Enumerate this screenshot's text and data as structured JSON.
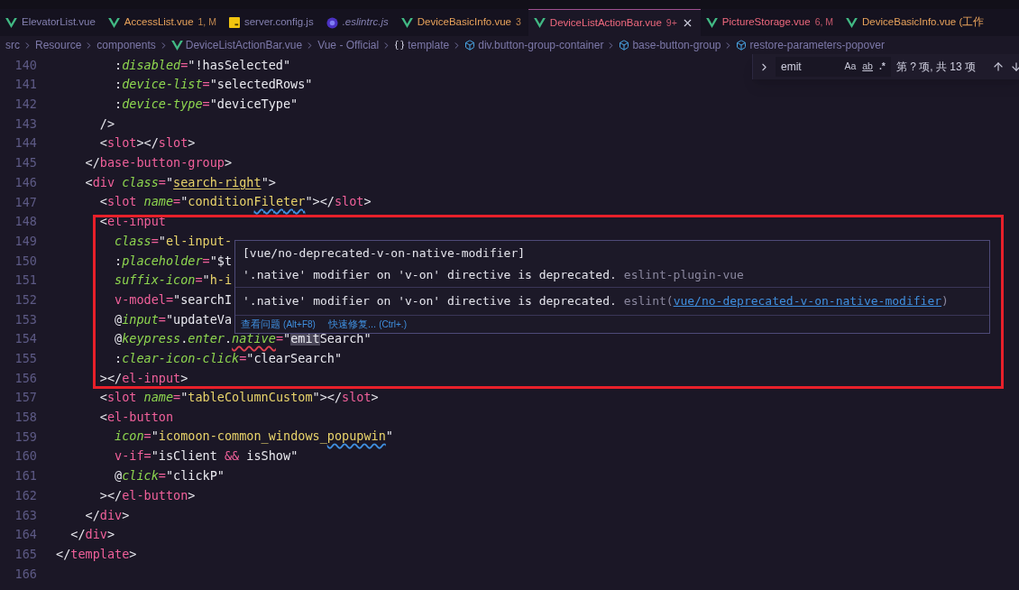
{
  "tabs": [
    {
      "label": "ElevatorList.vue",
      "kind": "vue",
      "color": "#8480b0",
      "selected": false
    },
    {
      "label": "AccessList.vue",
      "kind": "vue",
      "color": "#e9a35b",
      "badge": "1, M",
      "selected": false
    },
    {
      "label": "server.config.js",
      "kind": "js",
      "color": "#8480b0",
      "selected": false
    },
    {
      "label": ".eslintrc.js",
      "kind": "eslint",
      "color": "#8480b0",
      "italic": true,
      "selected": false
    },
    {
      "label": "DeviceBasicInfo.vue",
      "kind": "vue",
      "color": "#e9a35b",
      "badge": "3",
      "selected": false
    },
    {
      "label": "DeviceListActionBar.vue",
      "kind": "vue",
      "color": "#f0697e",
      "badge": "9+",
      "selected": true
    },
    {
      "label": "PictureStorage.vue",
      "kind": "vue",
      "color": "#f0697e",
      "badge": "6, M",
      "selected": false
    },
    {
      "label": "DeviceBasicInfo.vue (工作",
      "kind": "vue",
      "color": "#e9a35b",
      "selected": false
    }
  ],
  "breadcrumb": [
    {
      "label": "src"
    },
    {
      "label": "Resource"
    },
    {
      "label": "components"
    },
    {
      "label": "DeviceListActionBar.vue",
      "kind": "vue"
    },
    {
      "label": "Vue - Official"
    },
    {
      "label": "template",
      "kind": "braces"
    },
    {
      "label": "div.button-group-container",
      "kind": "cube"
    },
    {
      "label": "base-button-group",
      "kind": "cube"
    },
    {
      "label": "restore-parameters-popover",
      "kind": "cube"
    }
  ],
  "find": {
    "value": "emit",
    "options": [
      "Aa",
      "ab",
      ".*"
    ],
    "result": "第 ? 项, 共 13 项"
  },
  "lines": [
    {
      "number": "140",
      "tokens": [
        {
          "kind": "punct",
          "text": "        :"
        },
        {
          "kind": "attr",
          "text": "disabled"
        },
        {
          "kind": "op",
          "text": "="
        },
        {
          "kind": "expr",
          "text": "\"!hasSelected\""
        }
      ]
    },
    {
      "number": "141",
      "tokens": [
        {
          "kind": "punct",
          "text": "        :"
        },
        {
          "kind": "attr",
          "text": "device-list"
        },
        {
          "kind": "op",
          "text": "="
        },
        {
          "kind": "expr",
          "text": "\"selectedRows\""
        }
      ]
    },
    {
      "number": "142",
      "tokens": [
        {
          "kind": "punct",
          "text": "        :"
        },
        {
          "kind": "attr",
          "text": "device-type"
        },
        {
          "kind": "op",
          "text": "="
        },
        {
          "kind": "expr",
          "text": "\"deviceType\""
        }
      ]
    },
    {
      "number": "143",
      "tokens": [
        {
          "kind": "punct",
          "text": "      />"
        }
      ]
    },
    {
      "number": "144",
      "tokens": [
        {
          "kind": "punct",
          "text": "      <"
        },
        {
          "kind": "tag",
          "text": "slot"
        },
        {
          "kind": "punct",
          "text": "></"
        },
        {
          "kind": "tag",
          "text": "slot"
        },
        {
          "kind": "punct",
          "text": ">"
        }
      ]
    },
    {
      "number": "145",
      "tokens": [
        {
          "kind": "punct",
          "text": "    </"
        },
        {
          "kind": "tag",
          "text": "base-button-group"
        },
        {
          "kind": "punct",
          "text": ">"
        }
      ]
    },
    {
      "number": "146",
      "tokens": [
        {
          "kind": "punct",
          "text": "    <"
        },
        {
          "kind": "tag",
          "text": "div"
        },
        {
          "kind": "attr",
          "text": " class"
        },
        {
          "kind": "op",
          "text": "="
        },
        {
          "kind": "punct",
          "text": "\""
        },
        {
          "kind": "str",
          "text": "search-right",
          "underline": true
        },
        {
          "kind": "punct",
          "text": "\">"
        }
      ]
    },
    {
      "number": "147",
      "tokens": [
        {
          "kind": "punct",
          "text": "      <"
        },
        {
          "kind": "tag",
          "text": "slot"
        },
        {
          "kind": "attr",
          "text": " name"
        },
        {
          "kind": "op",
          "text": "="
        },
        {
          "kind": "punct",
          "text": "\""
        },
        {
          "kind": "str",
          "text": "condition"
        },
        {
          "kind": "str",
          "text": "Fileter",
          "misspelled": true
        },
        {
          "kind": "punct",
          "text": "\"></"
        },
        {
          "kind": "tag",
          "text": "slot"
        },
        {
          "kind": "punct",
          "text": ">"
        }
      ]
    },
    {
      "number": "148",
      "tokens": [
        {
          "kind": "punct",
          "text": "      <"
        },
        {
          "kind": "tag",
          "text": "el-input"
        }
      ]
    },
    {
      "number": "149",
      "tokens": [
        {
          "kind": "attr",
          "text": "        class"
        },
        {
          "kind": "op",
          "text": "="
        },
        {
          "kind": "punct",
          "text": "\""
        },
        {
          "kind": "str",
          "text": "el-input-"
        }
      ]
    },
    {
      "number": "150",
      "tokens": [
        {
          "kind": "punct",
          "text": "        :"
        },
        {
          "kind": "attr",
          "text": "placeholder"
        },
        {
          "kind": "op",
          "text": "="
        },
        {
          "kind": "expr",
          "text": "\"$t"
        }
      ]
    },
    {
      "number": "151",
      "tokens": [
        {
          "kind": "attr",
          "text": "        suffix-icon"
        },
        {
          "kind": "op",
          "text": "="
        },
        {
          "kind": "punct",
          "text": "\""
        },
        {
          "kind": "str",
          "text": "h-i"
        }
      ]
    },
    {
      "number": "152",
      "tokens": [
        {
          "kind": "op",
          "text": "        v-model"
        },
        {
          "kind": "op",
          "text": "="
        },
        {
          "kind": "expr",
          "text": "\"searchI"
        }
      ]
    },
    {
      "number": "153",
      "tokens": [
        {
          "kind": "punct",
          "text": "        @"
        },
        {
          "kind": "attr",
          "text": "input"
        },
        {
          "kind": "op",
          "text": "="
        },
        {
          "kind": "expr",
          "text": "\"updateVa"
        }
      ]
    },
    {
      "number": "154",
      "tokens": [
        {
          "kind": "punct",
          "text": "        @"
        },
        {
          "kind": "attr",
          "text": "keypress"
        },
        {
          "kind": "punct",
          "text": "."
        },
        {
          "kind": "attr",
          "text": "enter"
        },
        {
          "kind": "punct",
          "text": "."
        },
        {
          "kind": "attr",
          "text": "native",
          "error": true
        },
        {
          "kind": "op",
          "text": "="
        },
        {
          "kind": "expr",
          "text": "\""
        },
        {
          "kind": "expr",
          "text": "emit",
          "highlight": true
        },
        {
          "kind": "expr",
          "text": "Search\""
        }
      ]
    },
    {
      "number": "155",
      "tokens": [
        {
          "kind": "punct",
          "text": "        :"
        },
        {
          "kind": "attr",
          "text": "clear-icon-click"
        },
        {
          "kind": "op",
          "text": "="
        },
        {
          "kind": "expr",
          "text": "\"clearSearch\""
        }
      ]
    },
    {
      "number": "156",
      "tokens": [
        {
          "kind": "punct",
          "text": "      ></"
        },
        {
          "kind": "tag",
          "text": "el-input"
        },
        {
          "kind": "punct",
          "text": ">"
        }
      ]
    },
    {
      "number": "157",
      "tokens": [
        {
          "kind": "punct",
          "text": "      <"
        },
        {
          "kind": "tag",
          "text": "slot"
        },
        {
          "kind": "attr",
          "text": " name"
        },
        {
          "kind": "op",
          "text": "="
        },
        {
          "kind": "punct",
          "text": "\""
        },
        {
          "kind": "str",
          "text": "tableColumnCustom"
        },
        {
          "kind": "punct",
          "text": "\"></"
        },
        {
          "kind": "tag",
          "text": "slot"
        },
        {
          "kind": "punct",
          "text": ">"
        }
      ]
    },
    {
      "number": "158",
      "tokens": [
        {
          "kind": "punct",
          "text": "      <"
        },
        {
          "kind": "tag",
          "text": "el-button"
        }
      ]
    },
    {
      "number": "159",
      "tokens": [
        {
          "kind": "attr",
          "text": "        icon"
        },
        {
          "kind": "op",
          "text": "="
        },
        {
          "kind": "punct",
          "text": "\""
        },
        {
          "kind": "str",
          "text": "icomoon-common_windows_"
        },
        {
          "kind": "str",
          "text": "popupwin",
          "misspelled": true
        },
        {
          "kind": "punct",
          "text": "\""
        }
      ]
    },
    {
      "number": "160",
      "tokens": [
        {
          "kind": "op",
          "text": "        v-if"
        },
        {
          "kind": "op",
          "text": "="
        },
        {
          "kind": "expr",
          "text": "\"isClient "
        },
        {
          "kind": "op",
          "text": "&&"
        },
        {
          "kind": "expr",
          "text": " isShow\""
        }
      ]
    },
    {
      "number": "161",
      "tokens": [
        {
          "kind": "punct",
          "text": "        @"
        },
        {
          "kind": "attr",
          "text": "click"
        },
        {
          "kind": "op",
          "text": "="
        },
        {
          "kind": "expr",
          "text": "\"clickP\""
        }
      ]
    },
    {
      "number": "162",
      "tokens": [
        {
          "kind": "punct",
          "text": "      ></"
        },
        {
          "kind": "tag",
          "text": "el-button"
        },
        {
          "kind": "punct",
          "text": ">"
        }
      ]
    },
    {
      "number": "163",
      "tokens": [
        {
          "kind": "punct",
          "text": "    </"
        },
        {
          "kind": "tag",
          "text": "div"
        },
        {
          "kind": "punct",
          "text": ">"
        }
      ]
    },
    {
      "number": "164",
      "tokens": [
        {
          "kind": "punct",
          "text": "  </"
        },
        {
          "kind": "tag",
          "text": "div"
        },
        {
          "kind": "punct",
          "text": ">"
        }
      ]
    },
    {
      "number": "165",
      "tokens": [
        {
          "kind": "punct",
          "text": "</"
        },
        {
          "kind": "tag",
          "text": "template"
        },
        {
          "kind": "punct",
          "text": ">"
        }
      ]
    },
    {
      "number": "166"
    }
  ],
  "hover": {
    "title": "[vue/no-deprecated-v-on-native-modifier]",
    "problems": [
      {
        "message": "'.native' modifier on 'v-on' directive is deprecated.",
        "source": "eslint-plugin-vue"
      },
      {
        "message": "'.native' modifier on 'v-on' directive is deprecated.",
        "source_prefix": "eslint(",
        "rule_link": "vue/no-deprecated-v-on-native-modifier",
        "source_suffix": ")"
      }
    ],
    "actions": [
      {
        "label": "查看问题",
        "shortcut": "(Alt+F8)"
      },
      {
        "label": "快速修复...",
        "shortcut": "(Ctrl+.)"
      }
    ]
  }
}
